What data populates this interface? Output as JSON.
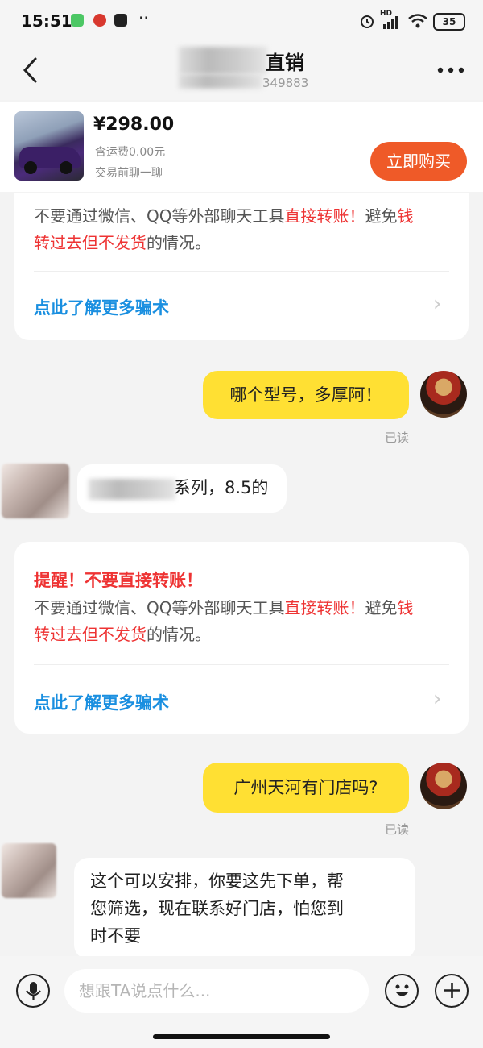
{
  "status_bar": {
    "time": "15:51",
    "hd": "HD",
    "battery": "35"
  },
  "header": {
    "title_visible": "直销",
    "subtitle_visible": "349883"
  },
  "product": {
    "price": "¥298.00",
    "shipping": "含运费0.00元",
    "note": "交易前聊一聊",
    "buy_button": "立即购买"
  },
  "warning_card_1": {
    "text_a": "不要通过微信、QQ等外部聊天工具",
    "text_red_a": "直接转账！",
    "text_b": "避免",
    "text_red_b1": "钱",
    "text_red_b2": "转过去但不发货",
    "text_c": "的情况。",
    "link": "点此了解更多骗术"
  },
  "messages": {
    "m1": {
      "text": "哪个型号，多厚阿！",
      "status": "已读"
    },
    "m2": {
      "text_visible": "系列，8.5的"
    },
    "m3": {
      "text": "广州天河有门店吗?",
      "status": "已读"
    },
    "m4": {
      "line1": "这个可以安排，你要这先下单，帮",
      "line2": "您筛选，现在联系好门店，怕您到",
      "line3": "时不要"
    }
  },
  "warning_card_2": {
    "title": "提醒！不要直接转账！",
    "text_a": "不要通过微信、QQ等外部聊天工具",
    "text_red_a": "直接转账！",
    "text_b": "避免",
    "text_red_b1": "钱",
    "text_red_b2": "转过去但不发货",
    "text_c": "的情况。",
    "link": "点此了解更多骗术"
  },
  "input": {
    "placeholder": "想跟TA说点什么..."
  },
  "icons": {
    "back": "back-icon",
    "more": "more-icon",
    "mic": "microphone-icon",
    "emoji": "emoji-icon",
    "plus": "plus-icon",
    "chevron": "chevron-right-icon"
  }
}
